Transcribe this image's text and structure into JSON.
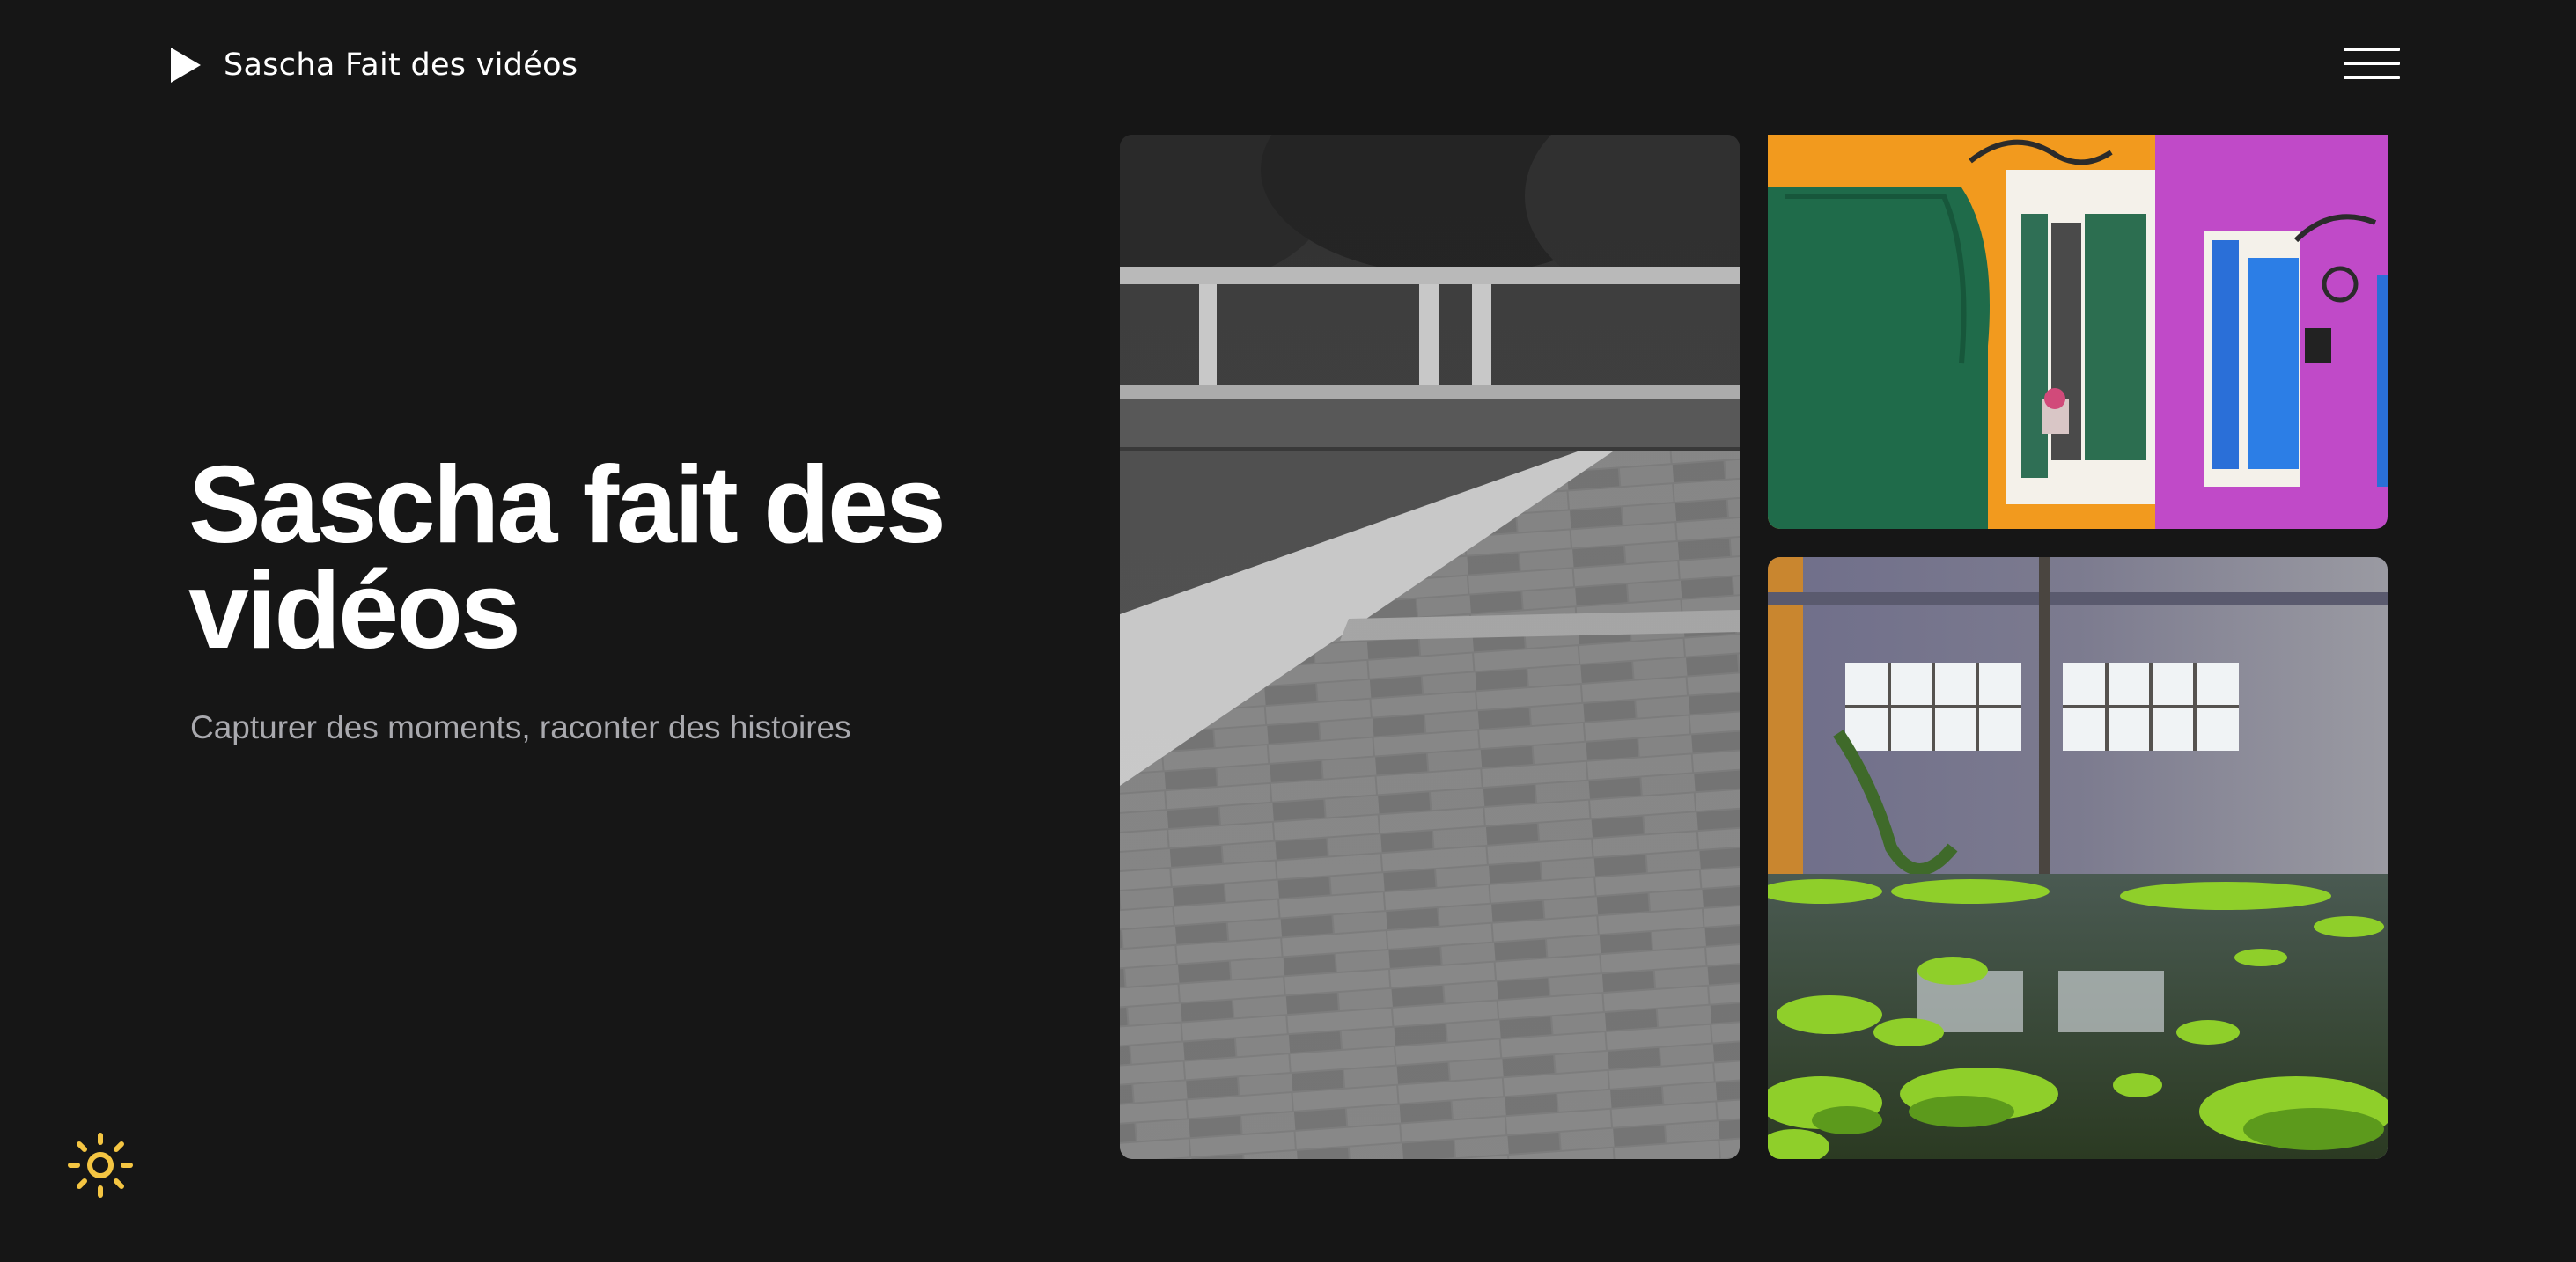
{
  "header": {
    "brand_name": "Sascha Fait des vidéos",
    "logo_icon": "play-icon",
    "menu_icon": "hamburger-menu-icon"
  },
  "hero": {
    "title_line1": "Sascha fait des",
    "title_line2": "vidéos",
    "subtitle": "Capturer des moments, raconter des histoires"
  },
  "gallery": {
    "photos": [
      {
        "name": "photo-stone-pier"
      },
      {
        "name": "photo-colorful-windows"
      },
      {
        "name": "photo-abandoned-room-moss"
      }
    ]
  },
  "theme_toggle": {
    "icon": "sun-icon",
    "color": "#f4c542"
  },
  "colors": {
    "background": "#161616",
    "text": "#ffffff",
    "muted_text": "#a9a9ae"
  }
}
